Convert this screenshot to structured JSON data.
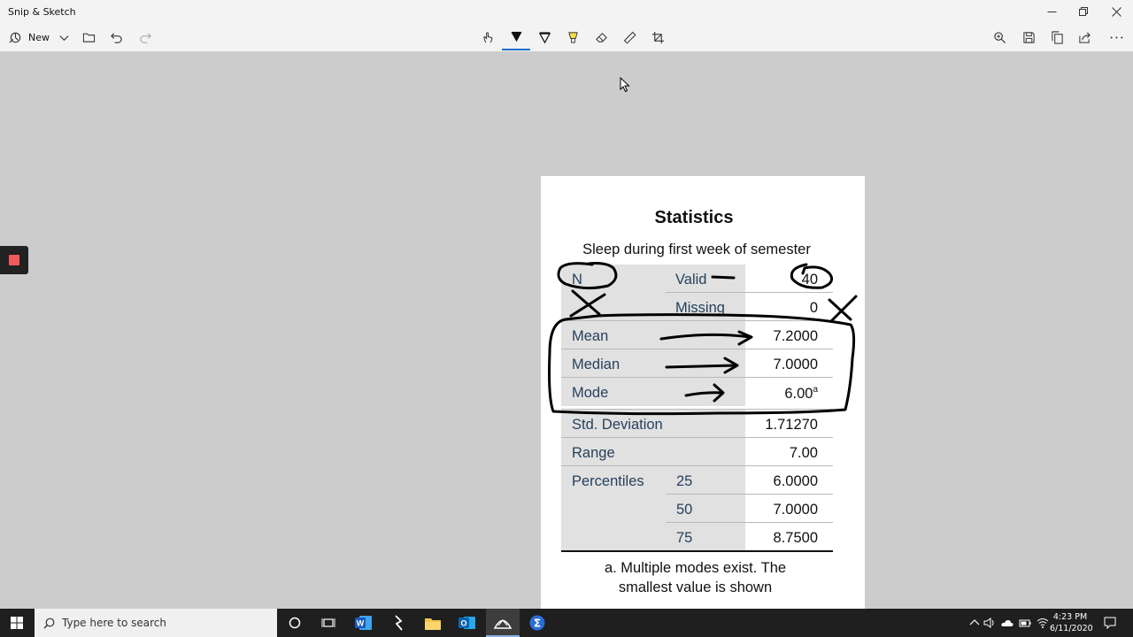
{
  "window": {
    "title": "Snip & Sketch"
  },
  "toolbar": {
    "new_label": "New",
    "tools": [
      "touch-writing-icon",
      "ballpoint-pen-icon",
      "pencil-icon",
      "highlighter-icon",
      "eraser-icon",
      "ruler-icon",
      "crop-icon"
    ],
    "active_tool": "ballpoint-pen-icon",
    "right_actions": [
      "zoom-icon",
      "save-icon",
      "copy-icon",
      "share-icon",
      "more-icon"
    ]
  },
  "document": {
    "title": "Statistics",
    "subtitle": "Sleep during first week of semester",
    "rows": [
      {
        "label": "N",
        "sublabel": "Valid",
        "value": "40"
      },
      {
        "label": "",
        "sublabel": "Missing",
        "value": "0"
      },
      {
        "label": "Mean",
        "sublabel": "",
        "value": "7.2000"
      },
      {
        "label": "Median",
        "sublabel": "",
        "value": "7.0000"
      },
      {
        "label": "Mode",
        "sublabel": "",
        "value": "6.00",
        "superscript": "a"
      },
      {
        "label": "Std. Deviation",
        "sublabel": "",
        "value": "1.71270"
      },
      {
        "label": "Range",
        "sublabel": "",
        "value": "7.00"
      },
      {
        "label": "Percentiles",
        "sublabel": "25",
        "value": "6.0000"
      },
      {
        "label": "",
        "sublabel": "50",
        "value": "7.0000"
      },
      {
        "label": "",
        "sublabel": "75",
        "value": "8.7500"
      }
    ],
    "footnote_line1": "a. Multiple modes exist. The",
    "footnote_line2": "smallest value is shown"
  },
  "taskbar": {
    "search_placeholder": "Type here to search",
    "time": "4:23 PM",
    "date": "6/11/2020"
  },
  "colors": {
    "accent": "#1a6fc9",
    "ink": "#000000",
    "record": "#f05a5a",
    "taskbar": "#1f1f1f"
  }
}
